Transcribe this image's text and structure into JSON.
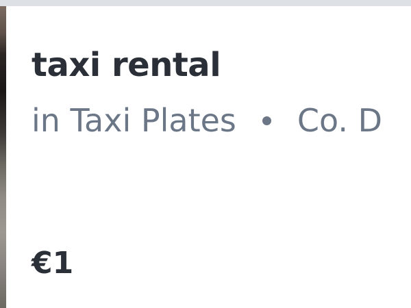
{
  "listing": {
    "title": "taxi rental",
    "category": "in Taxi Plates",
    "location": "Co. D",
    "price": "€1",
    "thumbnail_icon": "listing-photo"
  },
  "colors": {
    "title": "#2b2f38",
    "meta": "#6b7687",
    "background": "#ffffff",
    "top_border": "#dde0e5"
  }
}
